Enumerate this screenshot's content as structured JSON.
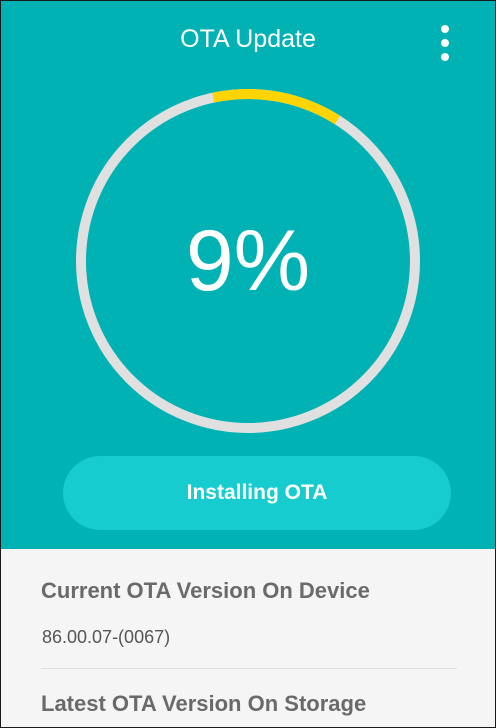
{
  "header": {
    "title": "OTA Update",
    "menu_icon": "more-vert-icon"
  },
  "progress": {
    "percent_text": "9%",
    "value": 0.09,
    "track_color": "#e0e0e0",
    "fill_color": "#ffd400"
  },
  "action": {
    "label": "Installing OTA"
  },
  "info": {
    "current_label": "Current OTA Version On Device",
    "current_value": "86.00.07-(0067)",
    "latest_label": "Latest OTA Version On Storage"
  },
  "colors": {
    "background": "#00b2b4",
    "button": "#17cccf",
    "panel": "#f5f5f5"
  }
}
